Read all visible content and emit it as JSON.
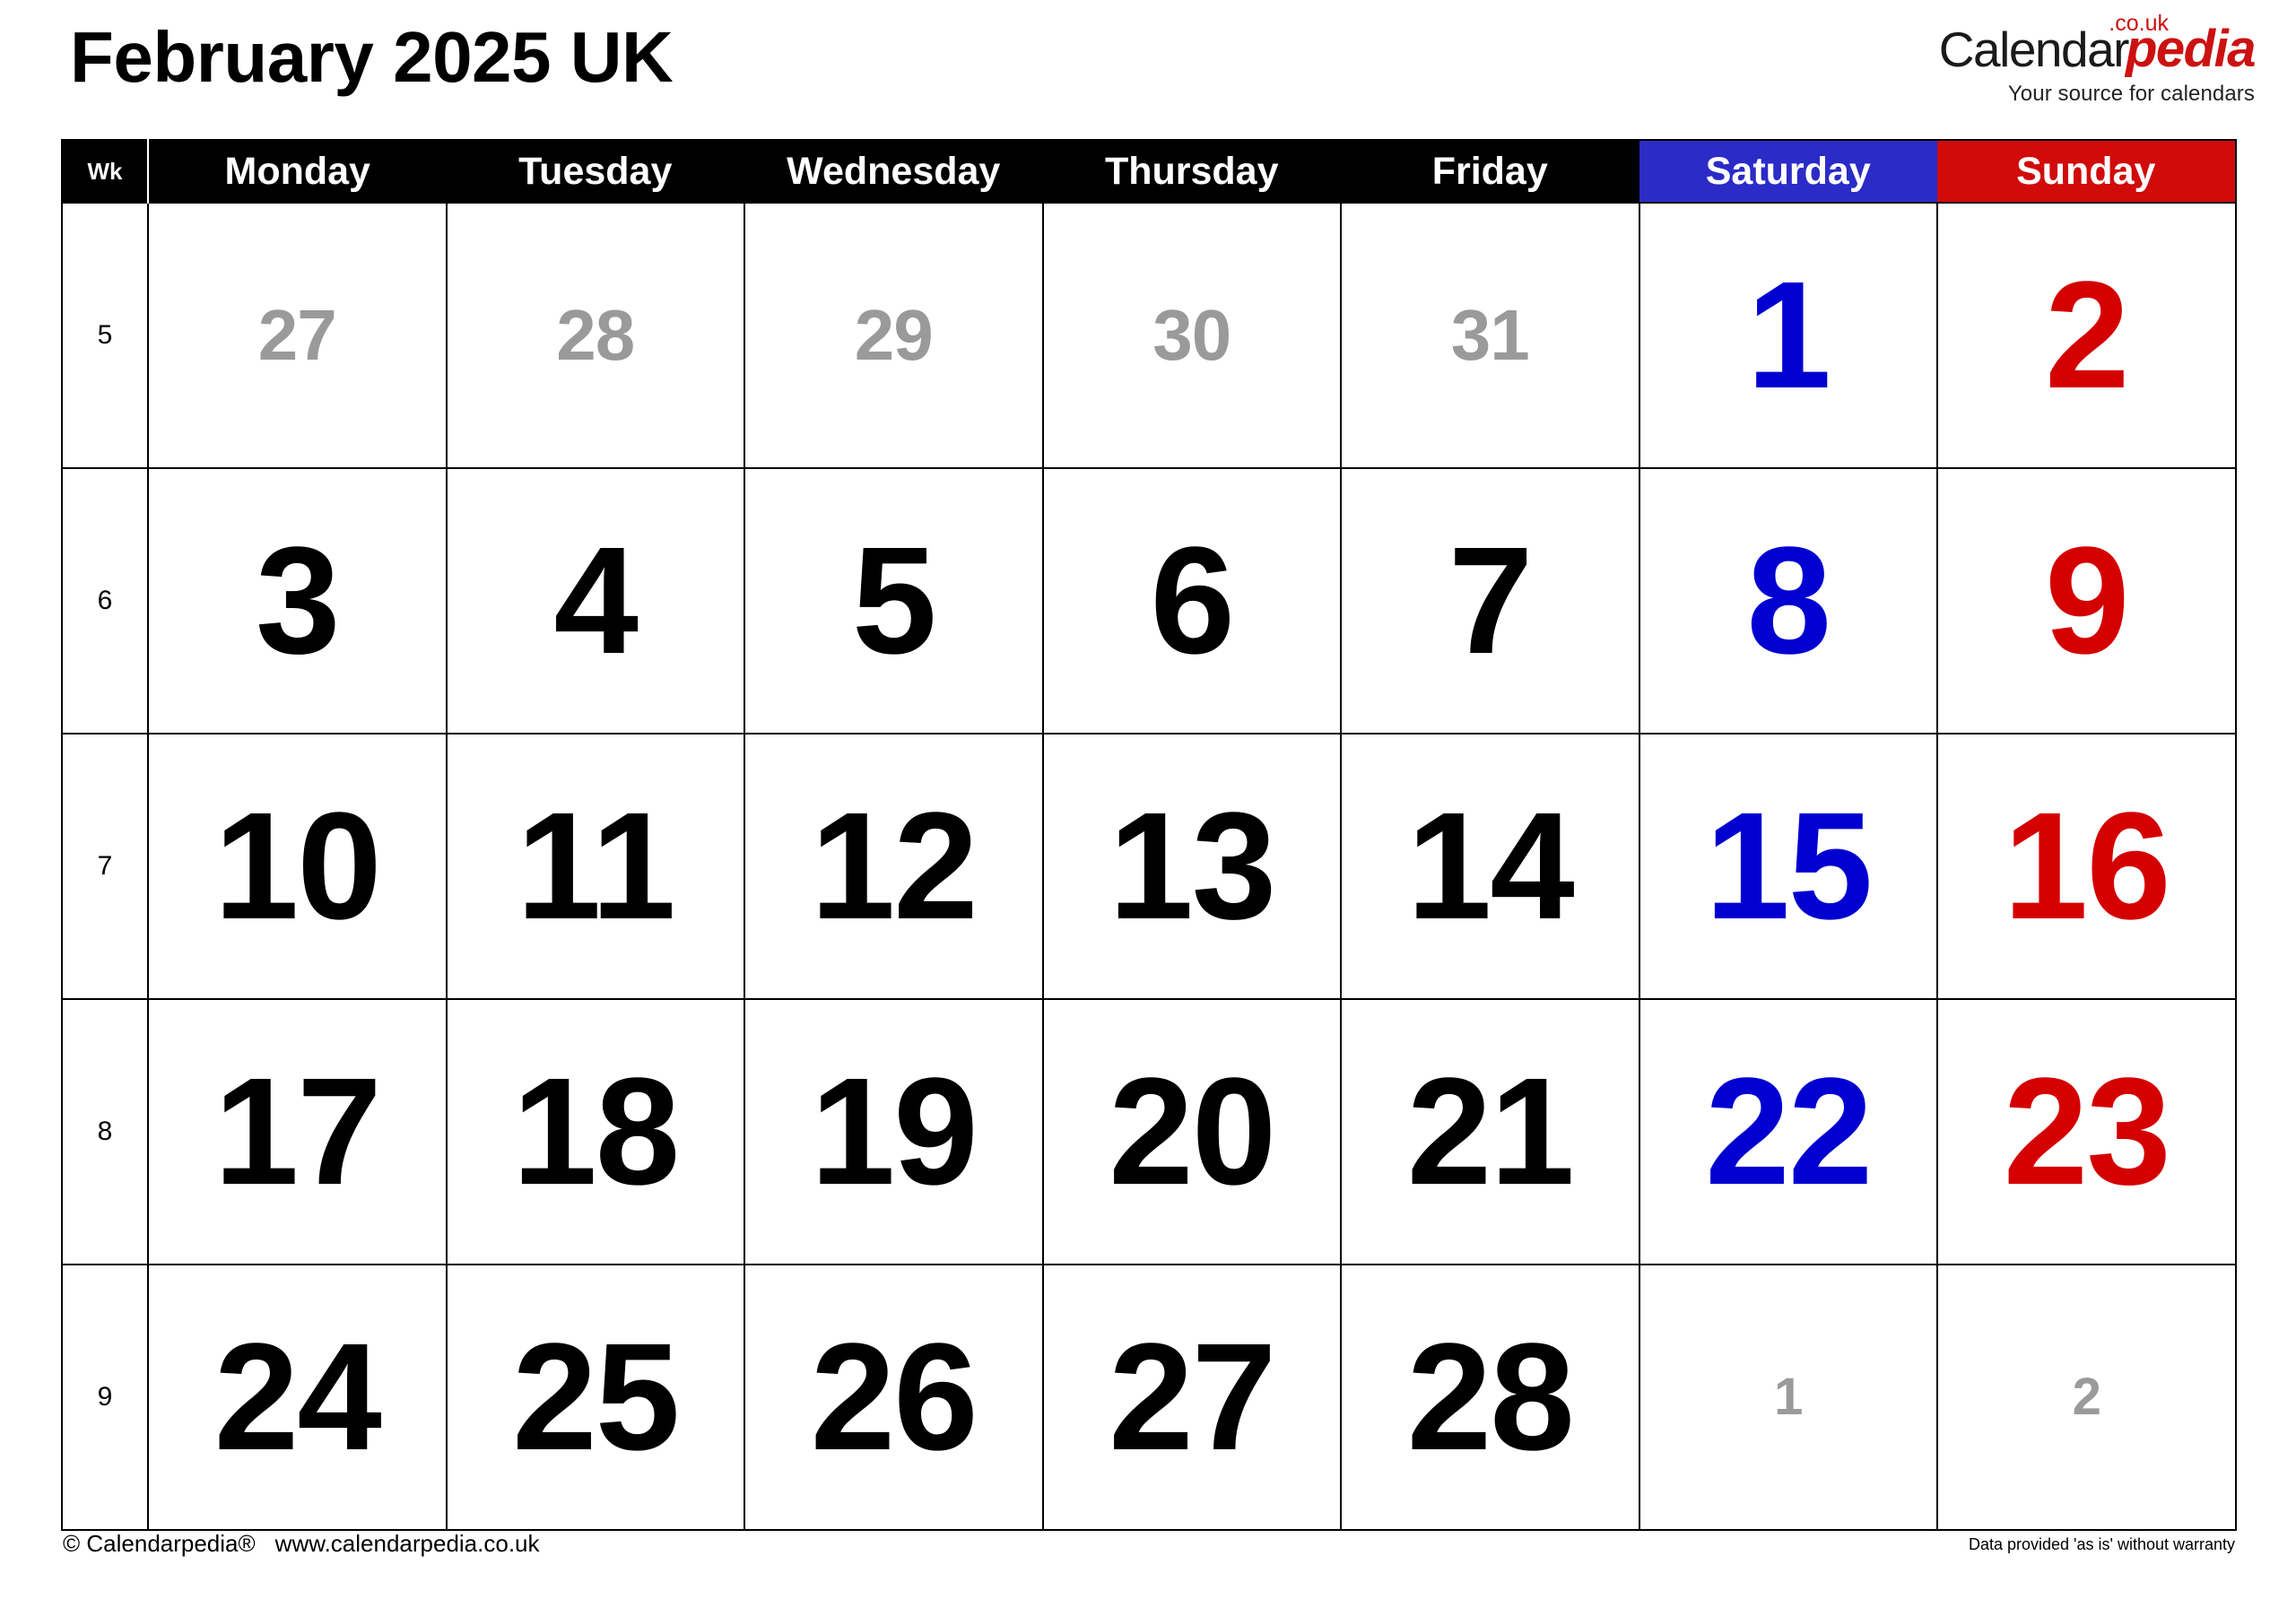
{
  "header": {
    "title": "February 2025 UK",
    "brand": {
      "name_first": "Calendar",
      "name_second": "pedia",
      "tld": ".co.uk",
      "tagline": "Your source for calendars"
    }
  },
  "colors": {
    "header_bg": "#000000",
    "saturday_header_bg": "#2b2bc8",
    "sunday_header_bg": "#d10a0a",
    "saturday_text": "#0000d0",
    "sunday_text": "#d40000",
    "other_month_text": "#9a9a9a",
    "grid_line": "#000000",
    "brand_accent": "#cc1111"
  },
  "table": {
    "week_column_label": "Wk",
    "day_headers": [
      "Monday",
      "Tuesday",
      "Wednesday",
      "Thursday",
      "Friday",
      "Saturday",
      "Sunday"
    ],
    "weeks": [
      {
        "week_number": "5",
        "days": [
          {
            "label": "27",
            "type": "other"
          },
          {
            "label": "28",
            "type": "other"
          },
          {
            "label": "29",
            "type": "other"
          },
          {
            "label": "30",
            "type": "other"
          },
          {
            "label": "31",
            "type": "other"
          },
          {
            "label": "1",
            "type": "sat"
          },
          {
            "label": "2",
            "type": "sun"
          }
        ]
      },
      {
        "week_number": "6",
        "days": [
          {
            "label": "3",
            "type": "weekday"
          },
          {
            "label": "4",
            "type": "weekday"
          },
          {
            "label": "5",
            "type": "weekday"
          },
          {
            "label": "6",
            "type": "weekday"
          },
          {
            "label": "7",
            "type": "weekday"
          },
          {
            "label": "8",
            "type": "sat"
          },
          {
            "label": "9",
            "type": "sun"
          }
        ]
      },
      {
        "week_number": "7",
        "days": [
          {
            "label": "10",
            "type": "weekday"
          },
          {
            "label": "11",
            "type": "weekday"
          },
          {
            "label": "12",
            "type": "weekday"
          },
          {
            "label": "13",
            "type": "weekday"
          },
          {
            "label": "14",
            "type": "weekday"
          },
          {
            "label": "15",
            "type": "sat"
          },
          {
            "label": "16",
            "type": "sun"
          }
        ]
      },
      {
        "week_number": "8",
        "days": [
          {
            "label": "17",
            "type": "weekday"
          },
          {
            "label": "18",
            "type": "weekday"
          },
          {
            "label": "19",
            "type": "weekday"
          },
          {
            "label": "20",
            "type": "weekday"
          },
          {
            "label": "21",
            "type": "weekday"
          },
          {
            "label": "22",
            "type": "sat"
          },
          {
            "label": "23",
            "type": "sun"
          }
        ]
      },
      {
        "week_number": "9",
        "days": [
          {
            "label": "24",
            "type": "weekday"
          },
          {
            "label": "25",
            "type": "weekday"
          },
          {
            "label": "26",
            "type": "weekday"
          },
          {
            "label": "27",
            "type": "weekday"
          },
          {
            "label": "28",
            "type": "weekday"
          },
          {
            "label": "1",
            "type": "other-small"
          },
          {
            "label": "2",
            "type": "other-small"
          }
        ]
      }
    ]
  },
  "footer": {
    "copyright": "© Calendarpedia®",
    "website": "www.calendarpedia.co.uk",
    "disclaimer": "Data provided 'as is' without warranty"
  }
}
